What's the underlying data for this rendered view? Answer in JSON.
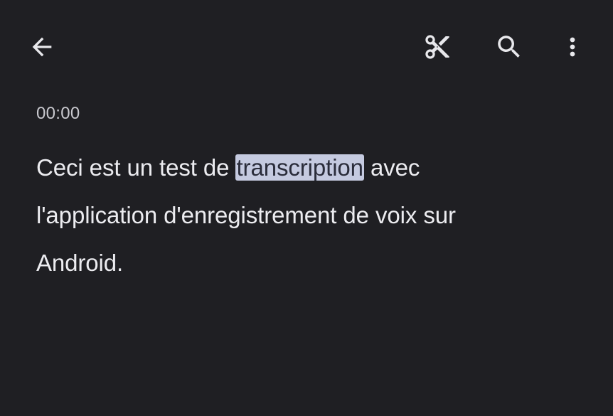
{
  "toolbar": {
    "back_icon": "arrow-back-icon",
    "trim_icon": "scissors-icon",
    "search_icon": "search-icon",
    "more_icon": "more-vert-icon"
  },
  "transcript": {
    "timestamp": "00:00",
    "line1_before": "Ceci est un test de ",
    "line1_highlight": "transcription",
    "line1_after": " avec",
    "line2": "l'application d'enregistrement de voix sur",
    "line3": "Android."
  },
  "colors": {
    "background": "#1f1f23",
    "text": "#ececf0",
    "timestamp": "#c9c9cf",
    "highlight_bg": "#c5cae0",
    "highlight_text": "#2a2c3a"
  }
}
